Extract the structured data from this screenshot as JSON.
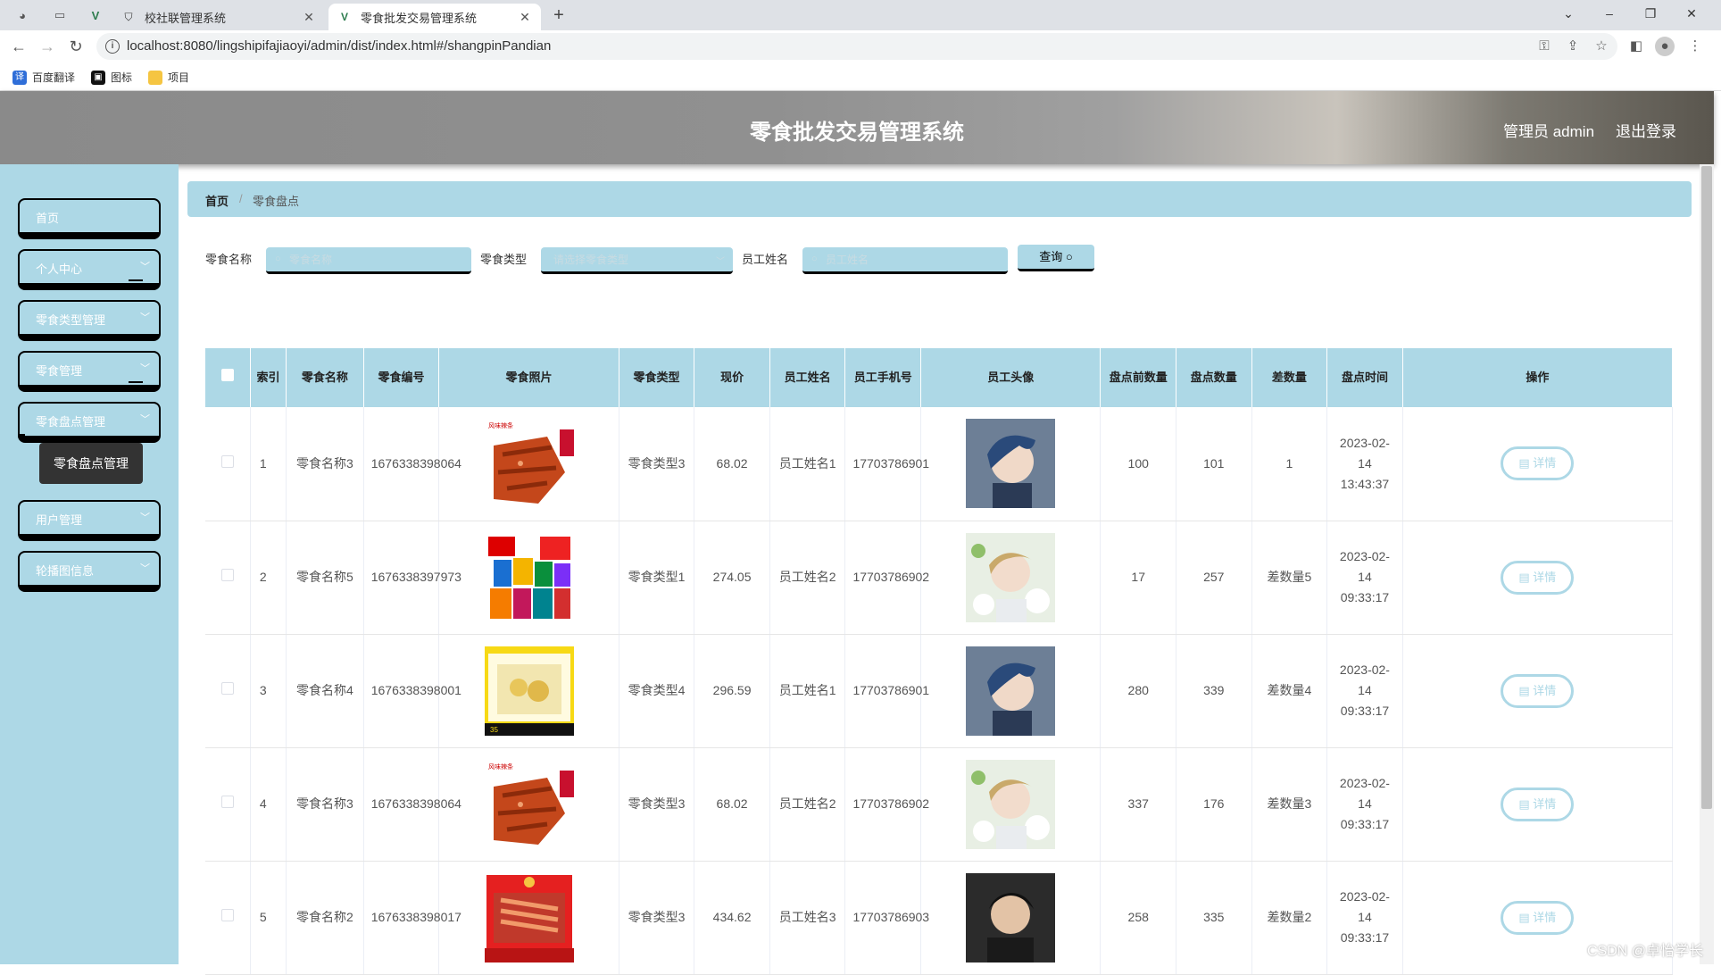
{
  "browser": {
    "tabs": [
      {
        "title": "校社联管理系统",
        "active": false
      },
      {
        "title": "零食批发交易管理系统",
        "active": true
      }
    ],
    "url": "localhost:8080/lingshipifajiaoyi/admin/dist/index.html#/shangpinPandian",
    "bookmarks": [
      "百度翻译",
      "图标",
      "项目"
    ]
  },
  "header": {
    "title": "零食批发交易管理系统",
    "admin": "管理员 admin",
    "logout": "退出登录"
  },
  "sidebar": {
    "items": [
      {
        "label": "首页",
        "has_arrow": false
      },
      {
        "label": "个人中心",
        "has_arrow": true
      },
      {
        "label": "零食类型管理",
        "has_arrow": true
      },
      {
        "label": "零食管理",
        "has_arrow": true
      },
      {
        "label": "零食盘点管理",
        "has_arrow": true
      },
      {
        "label": "用户管理",
        "has_arrow": true
      },
      {
        "label": "轮播图信息",
        "has_arrow": true
      }
    ],
    "submenu": "零食盘点管理"
  },
  "breadcrumb": {
    "home": "首页",
    "sep": "/",
    "current": "零食盘点"
  },
  "search": {
    "name_label": "零食名称",
    "name_placeholder": "零食名称",
    "type_label": "零食类型",
    "type_placeholder": "请选择零食类型",
    "employee_label": "员工姓名",
    "employee_placeholder": "员工姓名",
    "query_button": "查询"
  },
  "table": {
    "columns": [
      "索引",
      "零食名称",
      "零食编号",
      "零食照片",
      "零食类型",
      "现价",
      "员工姓名",
      "员工手机号",
      "员工头像",
      "盘点前数量",
      "盘点数量",
      "差数量",
      "盘点时间",
      "操作"
    ],
    "detail_label": "详情",
    "rows": [
      {
        "index": "1",
        "name": "零食名称3",
        "code": "1676338398064",
        "photo": "spicy-strips",
        "type": "零食类型3",
        "price": "68.02",
        "employee": "员工姓名1",
        "phone": "17703786901",
        "avatar": "blue-hair",
        "before": "100",
        "count": "101",
        "diff": "1",
        "time": "2023-02-14 13:43:37"
      },
      {
        "index": "2",
        "name": "零食名称5",
        "code": "1676338397973",
        "photo": "snack-pile",
        "type": "零食类型1",
        "price": "274.05",
        "employee": "员工姓名2",
        "phone": "17703786902",
        "avatar": "flowers",
        "before": "17",
        "count": "257",
        "diff": "差数量5",
        "time": "2023-02-14 09:33:17"
      },
      {
        "index": "3",
        "name": "零食名称4",
        "code": "1676338398001",
        "photo": "yellow-box",
        "type": "零食类型4",
        "price": "296.59",
        "employee": "员工姓名1",
        "phone": "17703786901",
        "avatar": "blue-hair",
        "before": "280",
        "count": "339",
        "diff": "差数量4",
        "time": "2023-02-14 09:33:17"
      },
      {
        "index": "4",
        "name": "零食名称3",
        "code": "1676338398064",
        "photo": "spicy-strips",
        "type": "零食类型3",
        "price": "68.02",
        "employee": "员工姓名2",
        "phone": "17703786902",
        "avatar": "flowers",
        "before": "337",
        "count": "176",
        "diff": "差数量3",
        "time": "2023-02-14 09:33:17"
      },
      {
        "index": "5",
        "name": "零食名称2",
        "code": "1676338398017",
        "photo": "red-box",
        "type": "零食类型3",
        "price": "434.62",
        "employee": "员工姓名3",
        "phone": "17703786903",
        "avatar": "dark-hair",
        "before": "258",
        "count": "335",
        "diff": "差数量2",
        "time": "2023-02-14 09:33:17"
      }
    ]
  },
  "watermark": "CSDN @卓怡学长",
  "colors": {
    "accent": "#add8e6",
    "header_gray": "#8a8a8a"
  }
}
